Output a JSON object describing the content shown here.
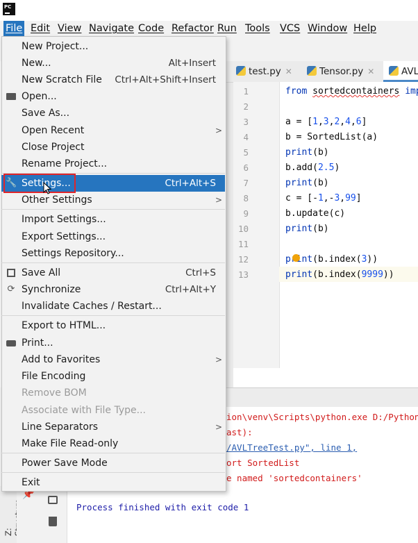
{
  "app": {
    "logo_text": "PC"
  },
  "menubar": {
    "items": [
      "File",
      "Edit",
      "View",
      "Navigate",
      "Code",
      "Refactor",
      "Run",
      "Tools",
      "VCS",
      "Window",
      "Help"
    ]
  },
  "tabs": [
    {
      "label": "test.py",
      "active": false
    },
    {
      "label": "Tensor.py",
      "active": false
    },
    {
      "label": "AVL",
      "active": true
    }
  ],
  "editor": {
    "line_numbers": [
      "1",
      "2",
      "3",
      "4",
      "5",
      "6",
      "7",
      "8",
      "9",
      "10",
      "11",
      "12",
      "13"
    ],
    "lines": [
      {
        "prefix": "from ",
        "mod": "sortedcontainers",
        "suffix": " impo"
      },
      {
        "text": ""
      },
      {
        "text": "a = [1,3,2,4,6]"
      },
      {
        "text": "b = SortedList(a)"
      },
      {
        "text": "print(b)"
      },
      {
        "text": "b.add(2.5)"
      },
      {
        "text": "print(b)"
      },
      {
        "text": "c = [-1,-3,99]"
      },
      {
        "text": "b.update(c)"
      },
      {
        "text": "print(b)"
      },
      {
        "text": ""
      },
      {
        "text": "print(b.index(3))"
      },
      {
        "text": "print(b.index(9999))"
      }
    ]
  },
  "console": {
    "lines": [
      "ion\\venv\\Scripts\\python.exe D:/PythonP",
      "ast):",
      "/AVLTreeTest.py\", line 1,",
      "ort SortedList",
      "e named 'sortedcontainers'"
    ],
    "process": "Process finished with exit code 1"
  },
  "structure_tab": "Z: Structure",
  "file_menu": {
    "items": [
      {
        "label": "New Project...",
        "shortcut": ""
      },
      {
        "label": "New...",
        "shortcut": "Alt+Insert"
      },
      {
        "label": "New Scratch File",
        "shortcut": "Ctrl+Alt+Shift+Insert"
      },
      {
        "label": "Open...",
        "shortcut": ""
      },
      {
        "label": "Save As...",
        "shortcut": ""
      },
      {
        "label": "Open Recent",
        "shortcut": ""
      },
      {
        "label": "Close Project",
        "shortcut": ""
      },
      {
        "label": "Rename Project...",
        "shortcut": ""
      },
      {
        "label": "Settings...",
        "shortcut": "Ctrl+Alt+S"
      },
      {
        "label": "Other Settings",
        "shortcut": ""
      },
      {
        "label": "Import Settings...",
        "shortcut": ""
      },
      {
        "label": "Export Settings...",
        "shortcut": ""
      },
      {
        "label": "Settings Repository...",
        "shortcut": ""
      },
      {
        "label": "Save All",
        "shortcut": "Ctrl+S"
      },
      {
        "label": "Synchronize",
        "shortcut": "Ctrl+Alt+Y"
      },
      {
        "label": "Invalidate Caches / Restart...",
        "shortcut": ""
      },
      {
        "label": "Export to HTML...",
        "shortcut": ""
      },
      {
        "label": "Print...",
        "shortcut": ""
      },
      {
        "label": "Add to Favorites",
        "shortcut": ""
      },
      {
        "label": "File Encoding",
        "shortcut": ""
      },
      {
        "label": "Remove BOM",
        "shortcut": ""
      },
      {
        "label": "Associate with File Type...",
        "shortcut": ""
      },
      {
        "label": "Line Separators",
        "shortcut": ""
      },
      {
        "label": "Make File Read-only",
        "shortcut": ""
      },
      {
        "label": "Power Save Mode",
        "shortcut": ""
      },
      {
        "label": "Exit",
        "shortcut": ""
      }
    ]
  },
  "colors": {
    "selection": "#2675bf",
    "highlight_box": "#e0252a",
    "keyword": "#0033b3",
    "number": "#1750eb",
    "error_text": "#d11a1a"
  }
}
